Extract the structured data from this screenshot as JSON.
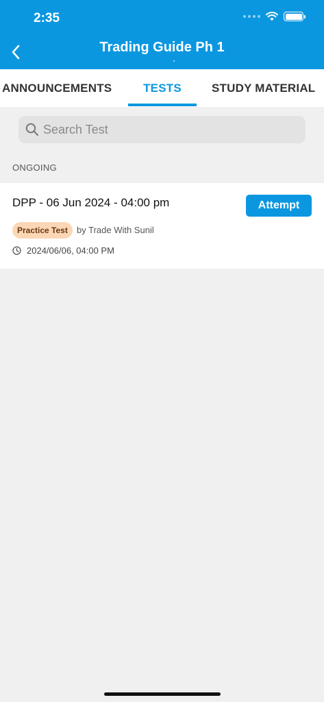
{
  "status_bar": {
    "time": "2:35",
    "icons": [
      "signal-dots-icon",
      "wifi-icon",
      "battery-icon"
    ]
  },
  "header": {
    "title": "Trading Guide Ph 1",
    "back_icon": "chevron-left-icon",
    "background_color": "#0a97e0"
  },
  "tabs": [
    {
      "label": "ANNOUNCEMENTS",
      "active": false
    },
    {
      "label": "TESTS",
      "active": true
    },
    {
      "label": "STUDY MATERIAL",
      "active": false
    }
  ],
  "accent_color": "#0a97e0",
  "search": {
    "placeholder": "Search Test",
    "value": "",
    "icon": "search-icon"
  },
  "section": {
    "label": "ONGOING"
  },
  "tests": [
    {
      "title": "DPP - 06 Jun 2024 - 04:00 pm",
      "action_label": "Attempt",
      "badge": "Practice Test",
      "badge_color": "#fbd7b5",
      "author": "by Trade With Sunil",
      "datetime": "2024/06/06, 04:00 PM",
      "datetime_icon": "clock-icon"
    }
  ]
}
